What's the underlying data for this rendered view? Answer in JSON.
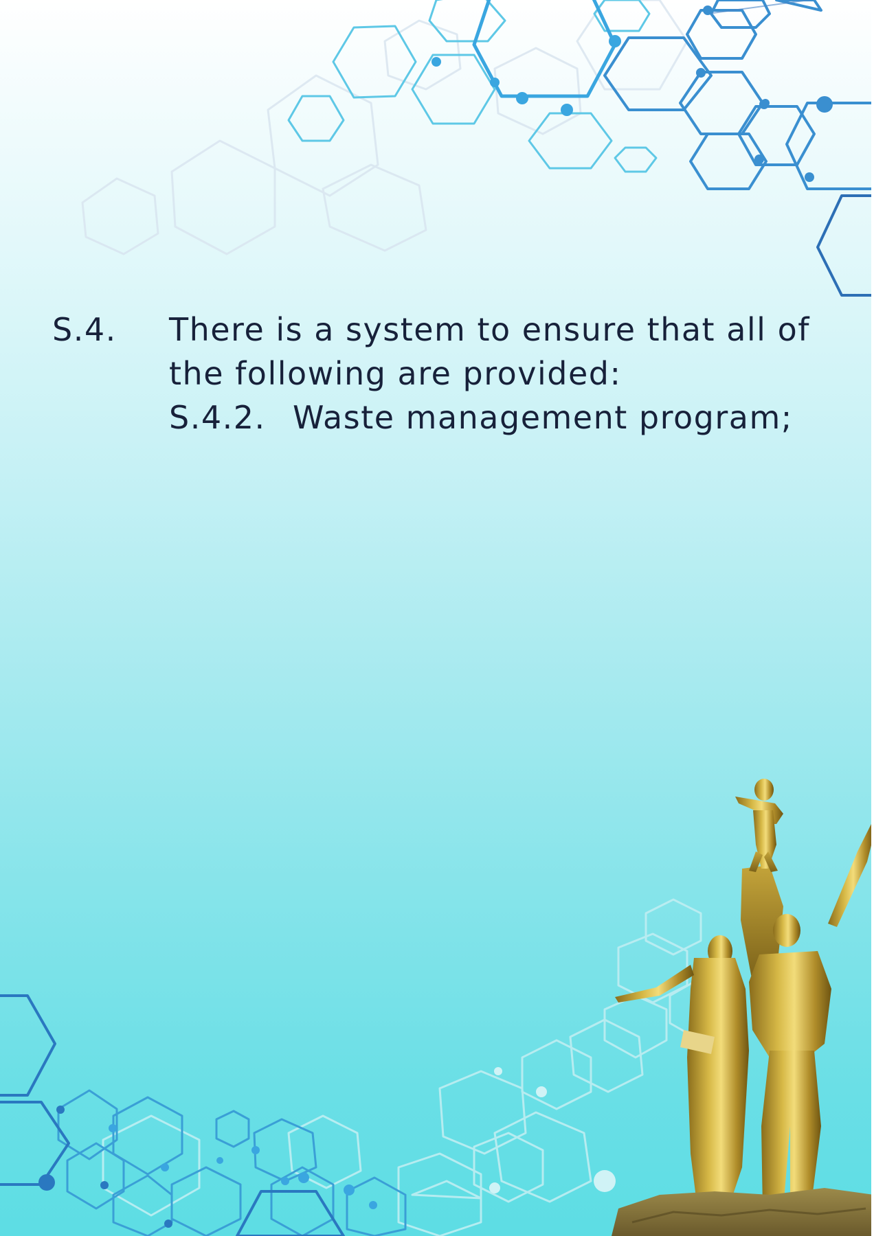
{
  "page": {
    "background_top": "#ffffff",
    "background_bottom": "#5ddde4",
    "text_color": "#17213a",
    "accent_colors": [
      "#3a9fd6",
      "#1d6fb8",
      "#5ec8e6"
    ]
  },
  "clause": {
    "number": "S.4.",
    "text": "There is a system to ensure that all of the following are provided:",
    "sub_item": {
      "number": "S.4.2.",
      "text": "Waste management program;"
    }
  },
  "decorations": {
    "top_right": "hexagon-network-icon",
    "bottom_left": "hexagon-network-icon",
    "bottom_right": "golden-monument-statue"
  }
}
